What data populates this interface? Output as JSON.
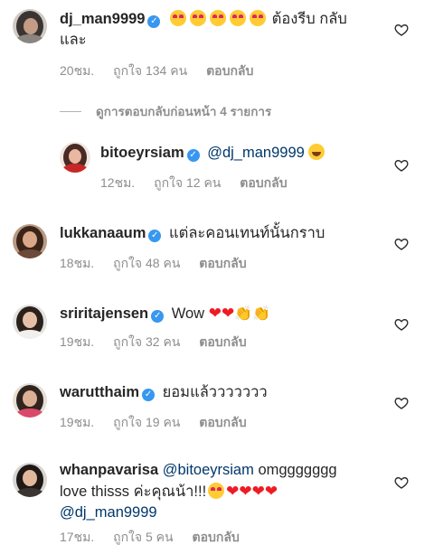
{
  "comments": [
    {
      "username": "dj_man9999",
      "text": "ต้องรีบ กลับและ",
      "time": "20ชม.",
      "likes": "ถูกใจ 134 คน",
      "reply": "ตอบกลับ"
    },
    {
      "username": "bitoeyrsiam",
      "mention": "@dj_man9999",
      "time": "12ชม.",
      "likes": "ถูกใจ 12 คน",
      "reply": "ตอบกลับ"
    },
    {
      "username": "lukkanaaum",
      "text": "แต่ละคอนเทนท์นั้นกราบ",
      "time": "18ชม.",
      "likes": "ถูกใจ 48 คน",
      "reply": "ตอบกลับ"
    },
    {
      "username": "sriritajensen",
      "text": "Wow",
      "time": "19ชม.",
      "likes": "ถูกใจ 32 คน",
      "reply": "ตอบกลับ"
    },
    {
      "username": "warutthaim",
      "text": "ยอมแล้ววววววว",
      "time": "19ชม.",
      "likes": "ถูกใจ 19 คน",
      "reply": "ตอบกลับ"
    },
    {
      "username": "whanpavarisa",
      "mention1": "@bitoeyrsiam",
      "text1": "omggggggg",
      "text2": "love thisss ค่ะคุณน้า!!!",
      "mention2": "@dj_man9999",
      "time": "17ชม.",
      "likes": "ถูกใจ 5 คน",
      "reply": "ตอบกลับ"
    }
  ],
  "view_previous_replies": "ดูการตอบกลับก่อนหน้า 4 รายการ",
  "icons": {
    "verified": "verified-badge-icon",
    "like": "heart-outline-icon"
  },
  "colors": {
    "verified": "#3897f0",
    "mention": "#00376b",
    "meta": "#8e8e8e",
    "heart_emoji": "#ed1c24"
  }
}
